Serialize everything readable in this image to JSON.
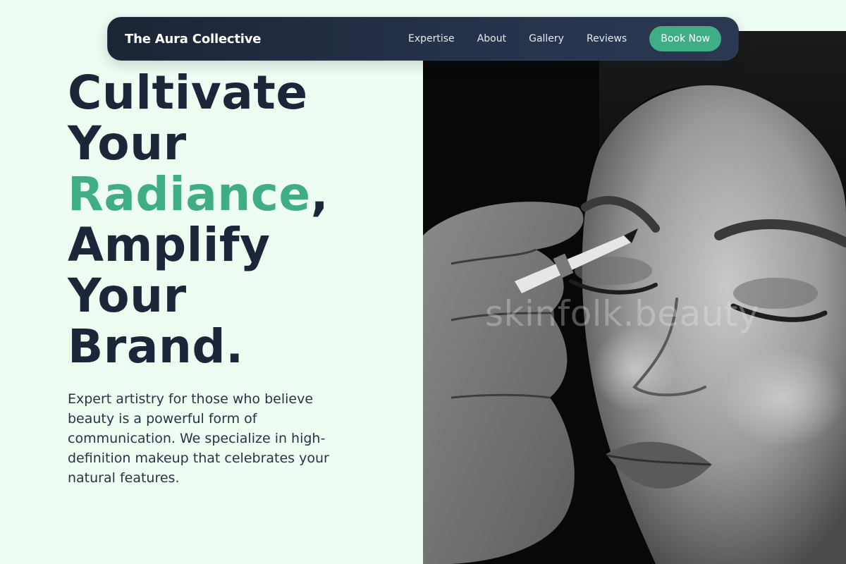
{
  "nav": {
    "brand": "The Aura Collective",
    "links": [
      "Expertise",
      "About",
      "Gallery",
      "Reviews"
    ],
    "cta_label": "Book Now"
  },
  "hero": {
    "headline_line1": "Cultivate",
    "headline_line2": "Your",
    "headline_accent": "Radiance",
    "headline_accent_suffix": ",",
    "headline_line4": "Amplify",
    "headline_line5": "Your",
    "headline_line6": "Brand.",
    "subtext": "Expert artistry for those who believe beauty is a powerful form of communication. We specialize in high-definition makeup that celebrates your natural features."
  },
  "photo": {
    "watermark": "skinfolk.beauty"
  },
  "colors": {
    "page_background": "#eefdf2",
    "nav_background": "#1c2535",
    "accent": "#3fae87",
    "heading": "#1b2638"
  }
}
